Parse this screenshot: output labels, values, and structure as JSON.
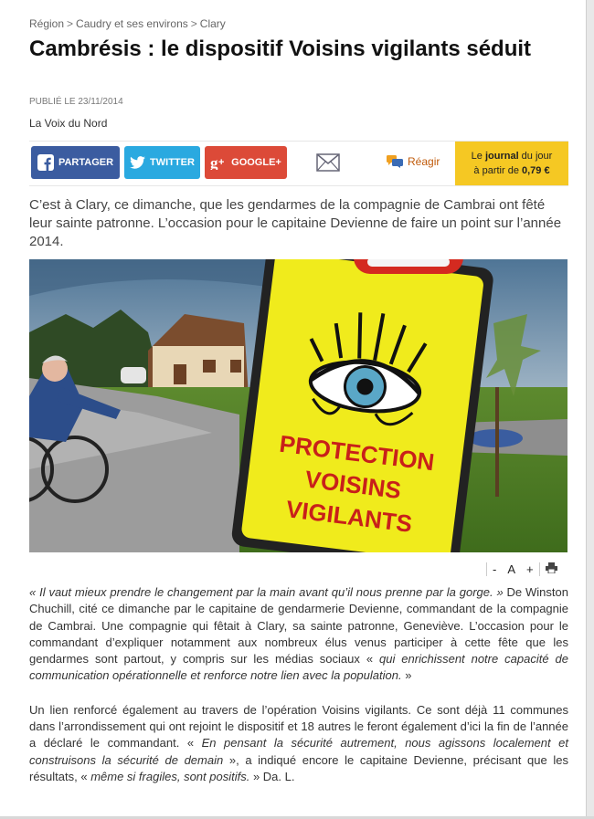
{
  "breadcrumb": {
    "items": [
      "Région",
      "Caudry et ses environs",
      "Clary"
    ],
    "separator": ">"
  },
  "article": {
    "title": "Cambrésis : le dispositif Voisins vigilants séduit",
    "published": "PUBLIÉ LE 23/11/2014",
    "source": "La Voix du Nord",
    "lead": "C’est à Clary, ce dimanche, que les gendarmes de la compagnie de Cambrai ont fêté leur sainte patronne. L’occasion pour le capitaine Devienne de faire un point sur l’année 2014.",
    "p1": {
      "q1": "« Il vaut mieux prendre le changement par la main avant qu’il nous prenne par la gorge. »",
      "t1": " De Winston Chuchill, cité ce dimanche par le capitaine de gendarmerie Devienne, commandant de la compagnie de Cambrai. Une compagnie qui fêtait à Clary, sa sainte patronne, Geneviève. L’occasion pour le commandant d’expliquer notamment aux nombreux élus venus participer à cette fête que les gendarmes sont partout, y compris sur les médias sociaux « ",
      "q2": "qui enrichissent notre capacité de communication opérationnelle et renforce notre lien avec la population.",
      "t2": " »"
    },
    "p2": {
      "t1": "Un lien renforcé également au travers de l’opération Voisins vigilants. Ce sont déjà 11 communes dans l’arrondissement qui ont rejoint le dispositif et 18 autres le feront également d’ici la fin de l’année a déclaré le commandant. « ",
      "q1": "En pensant la sécurité autrement, nous agissons localement et construisons la sécurité de demain",
      "t2": " », a indiqué encore le capitaine Devienne, précisant que les résultats, « ",
      "q2": "même si fragiles, sont positifs.",
      "t3": " » Da. L."
    }
  },
  "share": {
    "facebook_label": "PARTAGER",
    "twitter_label": "TWITTER",
    "google_label": "GOOGLE+",
    "react_label": "Réagir",
    "journal": {
      "line1_a": "Le ",
      "line1_b": "journal",
      "line1_c": " du jour",
      "line2_a": "à partir de ",
      "line2_b": "0,79 €"
    }
  },
  "photo": {
    "sign_line1": "PROTECTION",
    "sign_line2": "VOISINS",
    "sign_line3": "VIGILANTS"
  },
  "tools": {
    "decrease": "-",
    "font": "A",
    "increase": "+"
  },
  "icons": [
    "facebook-icon",
    "twitter-icon",
    "google-plus-icon",
    "mail-icon",
    "comment-icon",
    "print-icon"
  ],
  "colors": {
    "facebook": "#3b5ca0",
    "twitter": "#2aa9e0",
    "google": "#dc4a38",
    "journal": "#f5c823",
    "react": "#c05a0a"
  }
}
